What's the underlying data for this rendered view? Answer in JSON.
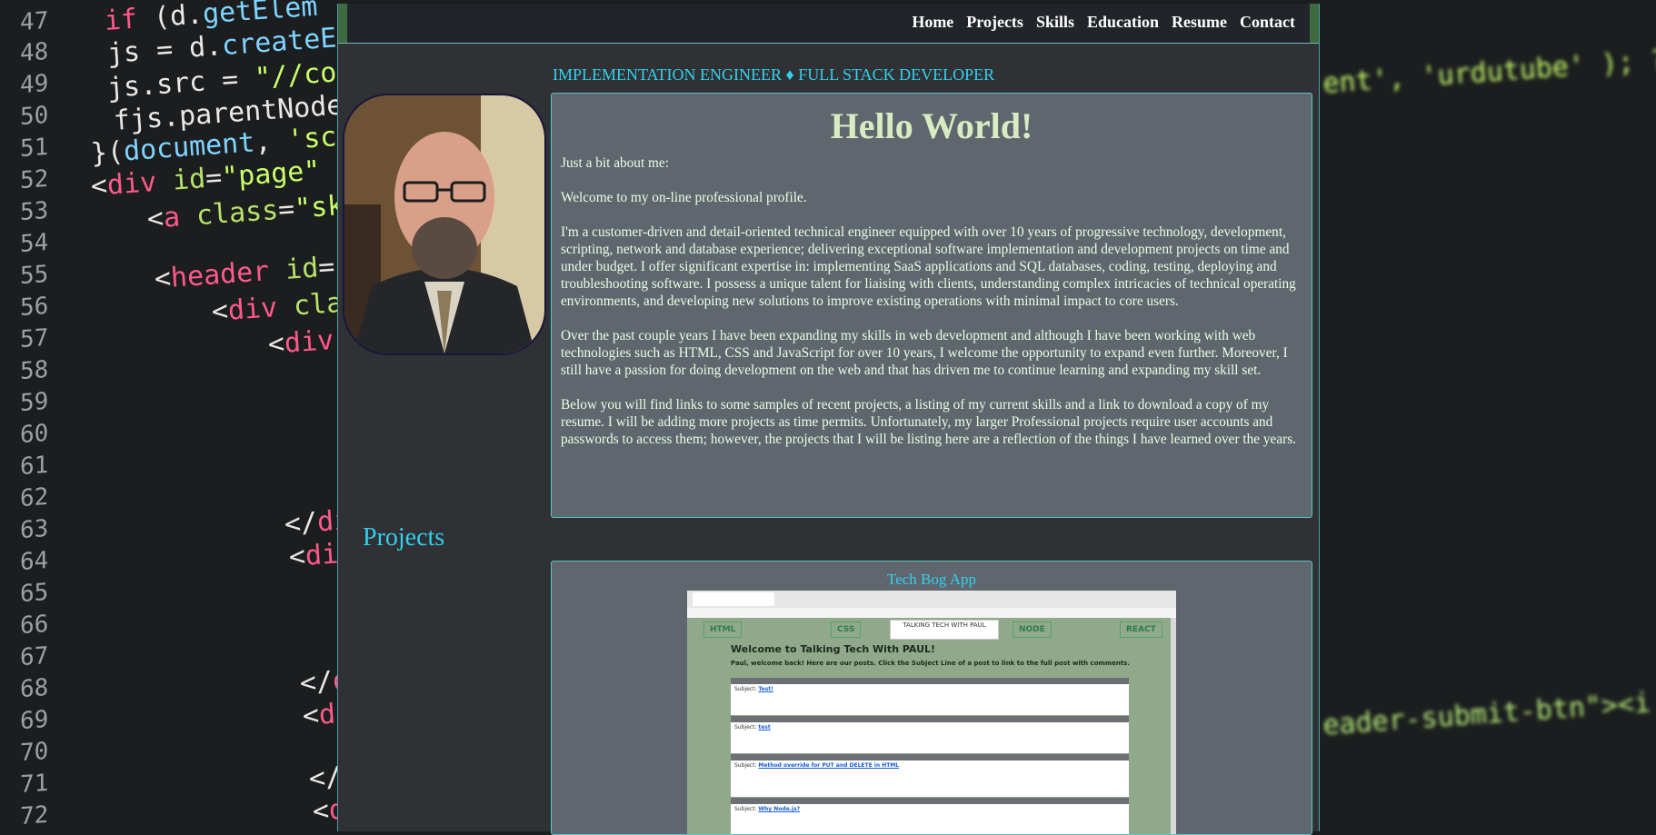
{
  "background": {
    "line_numbers": [
      "47",
      "48",
      "49",
      "50",
      "51",
      "52",
      "53",
      "54",
      "55",
      "56",
      "57",
      "58",
      "59",
      "60",
      "61",
      "62",
      "63",
      "64",
      "65",
      "66",
      "67",
      "68",
      "69",
      "70",
      "71",
      "72"
    ],
    "code_right": [
      "ent', 'urdutube' ); ?></",
      "eader-submit-btn\"><i class"
    ]
  },
  "nav": {
    "links": [
      "Home",
      "Projects",
      "Skills",
      "Education",
      "Resume",
      "Contact"
    ]
  },
  "header": {
    "subtitle": "IMPLEMENTATION ENGINEER ♦ FULL STACK DEVELOPER"
  },
  "about": {
    "heading": "Hello World!",
    "paragraphs": [
      "Just a bit about me:",
      "Welcome to my on-line professional profile.",
      "I'm a customer-driven and detail-oriented technical engineer equipped with over 10 years of progressive technology, development, scripting, network and database experience; delivering exceptional software implementation and development projects on time and under budget. I offer significant expertise in: implementing SaaS applications and SQL databases, coding, testing, deploying and troubleshooting software. I possess a unique talent for liaising with clients, understanding complex intricacies of technical operating environments, and developing new solutions to improve existing operations with minimal impact to core users.",
      "Over the past couple years I have been expanding my skills in web development and although I have been working with web technologies such as HTML, CSS and JavaScript for over 10 years, I welcome the opportunity to expand even further. Moreover, I still have a passion for doing development on the web and that has driven me to continue learning and expanding my skill set.",
      "Below you will find links to some samples of recent projects, a listing of my current skills and a link to download a copy of my resume. I will be adding more projects as time permits. Unfortunately, my larger Professional projects require user accounts and passwords to access them; however, the projects that I will be listing here are a reflection of the things I have learned over the years."
    ]
  },
  "projects": {
    "heading": "Projects",
    "items": [
      {
        "title": "Tech Bog App",
        "screenshot": {
          "nav_buttons": [
            "HTML",
            "CSS",
            "NODE",
            "REACT"
          ],
          "logo_text": "TALKING TECH WITH PAUL",
          "heading": "Welcome to Talking Tech With PAUL!",
          "subheading": "Paul, welcome back! Here are our posts. Click the Subject Line of a post to link to the full post with comments.",
          "posts": [
            {
              "subject": "Test!"
            },
            {
              "subject": "test"
            },
            {
              "subject": "Method override for PUT and DELETE in HTML"
            },
            {
              "subject": "Why Node.js?"
            }
          ]
        }
      }
    ]
  }
}
